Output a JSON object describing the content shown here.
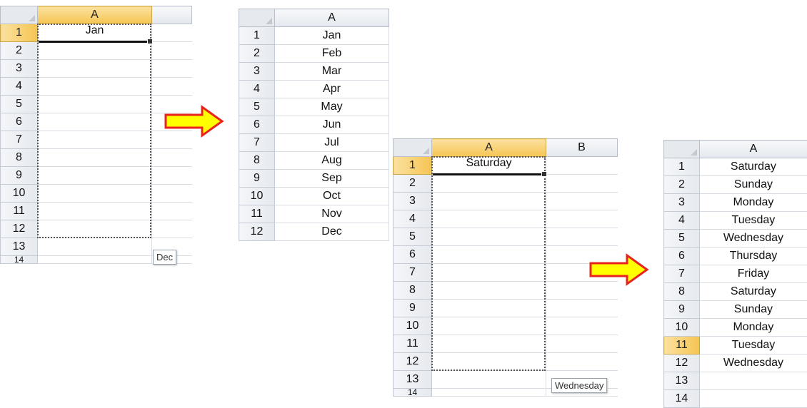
{
  "panel1": {
    "col_header": "A",
    "row_numbers": [
      "1",
      "2",
      "3",
      "4",
      "5",
      "6",
      "7",
      "8",
      "9",
      "10",
      "11",
      "12",
      "13",
      "14"
    ],
    "cells": [
      "Jan",
      "",
      "",
      "",
      "",
      "",
      "",
      "",
      "",
      "",
      "",
      "",
      "",
      ""
    ],
    "fill_tooltip": "Dec"
  },
  "panel2": {
    "col_header": "A",
    "row_numbers": [
      "1",
      "2",
      "3",
      "4",
      "5",
      "6",
      "7",
      "8",
      "9",
      "10",
      "11",
      "12"
    ],
    "cells": [
      "Jan",
      "Feb",
      "Mar",
      "Apr",
      "May",
      "Jun",
      "Jul",
      "Aug",
      "Sep",
      "Oct",
      "Nov",
      "Dec"
    ]
  },
  "panel3": {
    "col_headers": [
      "A",
      "B"
    ],
    "row_numbers": [
      "1",
      "2",
      "3",
      "4",
      "5",
      "6",
      "7",
      "8",
      "9",
      "10",
      "11",
      "12",
      "13",
      "14"
    ],
    "cells": [
      "Saturday",
      "",
      "",
      "",
      "",
      "",
      "",
      "",
      "",
      "",
      "",
      "",
      "",
      ""
    ],
    "fill_tooltip": "Wednesday"
  },
  "panel4": {
    "col_header": "A",
    "row_numbers": [
      "1",
      "2",
      "3",
      "4",
      "5",
      "6",
      "7",
      "8",
      "9",
      "10",
      "11",
      "12",
      "13",
      "14"
    ],
    "cells": [
      "Saturday",
      "Sunday",
      "Monday",
      "Tuesday",
      "Wednesday",
      "Thursday",
      "Friday",
      "Saturday",
      "Sunday",
      "Monday",
      "Tuesday",
      "Wednesday",
      "",
      ""
    ],
    "selected_row": "11"
  },
  "colors": {
    "arrow_fill": "#ffff00",
    "arrow_stroke": "#e8231d",
    "selected_header": "#f6c552"
  },
  "icons": [
    "select-all-corner-icon",
    "right-arrow-icon"
  ]
}
